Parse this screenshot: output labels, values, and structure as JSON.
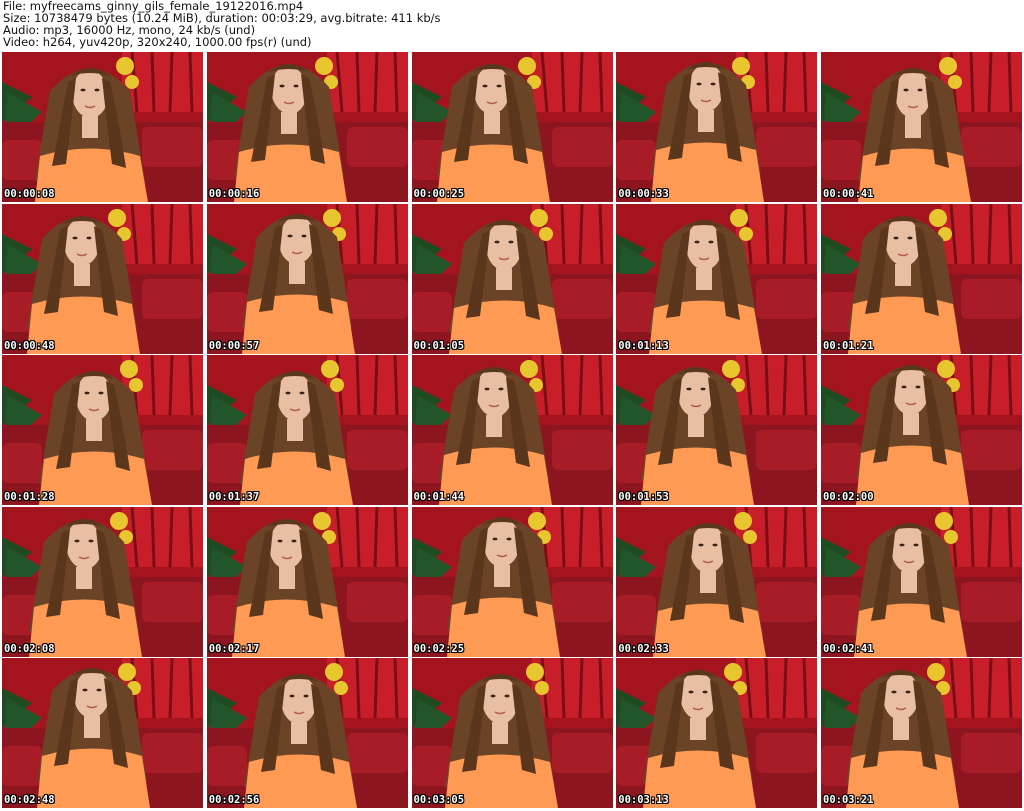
{
  "header": {
    "file_line": "File: myfreecams_ginny_gils_female_19122016.mp4",
    "size_line": "Size: 10738479 bytes (10.24 MiB), duration: 00:03:29, avg.bitrate: 411 kb/s",
    "audio_line": "Audio: mp3, 16000 Hz, mono, 24 kb/s (und)",
    "video_line": "Video: h264, yuv420p, 320x240, 1000.00 fps(r) (und)"
  },
  "colors": {
    "curtain_red": "#a3141f",
    "sofa_red": "#8c1520",
    "top_orange": "#ff9a55",
    "hair_brown": "#6b4326",
    "skin": "#e8bfa3",
    "gold_decoration": "#e8c630",
    "tree_green": "#1f4a22"
  },
  "thumbnails": [
    {
      "timestamp": "00:00:08"
    },
    {
      "timestamp": "00:00:16"
    },
    {
      "timestamp": "00:00:25"
    },
    {
      "timestamp": "00:00:33"
    },
    {
      "timestamp": "00:00:41"
    },
    {
      "timestamp": "00:00:48"
    },
    {
      "timestamp": "00:00:57"
    },
    {
      "timestamp": "00:01:05"
    },
    {
      "timestamp": "00:01:13"
    },
    {
      "timestamp": "00:01:21"
    },
    {
      "timestamp": "00:01:28"
    },
    {
      "timestamp": "00:01:37"
    },
    {
      "timestamp": "00:01:44"
    },
    {
      "timestamp": "00:01:53"
    },
    {
      "timestamp": "00:02:00"
    },
    {
      "timestamp": "00:02:08"
    },
    {
      "timestamp": "00:02:17"
    },
    {
      "timestamp": "00:02:25"
    },
    {
      "timestamp": "00:02:33"
    },
    {
      "timestamp": "00:02:41"
    },
    {
      "timestamp": "00:02:48"
    },
    {
      "timestamp": "00:02:56"
    },
    {
      "timestamp": "00:03:05"
    },
    {
      "timestamp": "00:03:13"
    },
    {
      "timestamp": "00:03:21"
    }
  ]
}
